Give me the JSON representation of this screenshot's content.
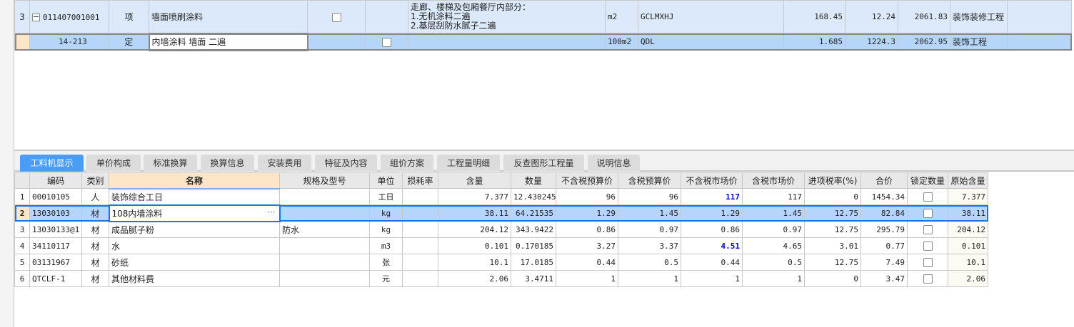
{
  "top_rows": [
    {
      "no": "3",
      "code": "011407001001",
      "type": "项",
      "name": "墙面喷刷涂料",
      "desc": [
        "走廊、楼梯及包厢餐厅内部分：",
        "1.无机涂料二遍",
        "2.基层刮防水腻子二遍"
      ],
      "unit": "m2",
      "expr": "GCLMXHJ",
      "qty": "168.45",
      "price": "12.24",
      "total": "2061.83",
      "category": "装饰装修工程"
    },
    {
      "no": "",
      "code": "14-213",
      "type": "定",
      "name": "内墙涂料 墙面 二遍",
      "desc": [],
      "unit": "100m2",
      "expr": "QDL",
      "qty": "1.685",
      "price": "1224.3",
      "total": "2062.95",
      "category": "装饰工程"
    }
  ],
  "tabs": [
    "工料机显示",
    "单价构成",
    "标准换算",
    "换算信息",
    "安装费用",
    "特征及内容",
    "组价方案",
    "工程量明细",
    "反查图形工程量",
    "说明信息"
  ],
  "headers": [
    "编码",
    "类别",
    "名称",
    "规格及型号",
    "单位",
    "损耗率",
    "含量",
    "数量",
    "不含税预算价",
    "含税预算价",
    "不含税市场价",
    "含税市场价",
    "进项税率(%)",
    "合价",
    "锁定数量",
    "原始含量"
  ],
  "rows": [
    {
      "no": "1",
      "code": "00010105",
      "type": "人",
      "name": "装饰综合工日",
      "spec": "",
      "unit": "工日",
      "loss": "",
      "content": "7.377",
      "count": "12.430245",
      "p1": "96",
      "p2": "96",
      "p3": "117",
      "p4": "117",
      "tax": "0",
      "sum": "1454.34",
      "orig": "7.377"
    },
    {
      "no": "2",
      "code": "13030103",
      "type": "材",
      "name": "108内墙涂料",
      "spec": "",
      "unit": "kg",
      "loss": "",
      "content": "38.11",
      "count": "64.21535",
      "p1": "1.29",
      "p2": "1.45",
      "p3": "1.29",
      "p4": "1.45",
      "tax": "12.75",
      "sum": "82.84",
      "orig": "38.11"
    },
    {
      "no": "3",
      "code": "13030133@1",
      "type": "材",
      "name": "成品腻子粉",
      "spec": "防水",
      "unit": "kg",
      "loss": "",
      "content": "204.12",
      "count": "343.9422",
      "p1": "0.86",
      "p2": "0.97",
      "p3": "0.86",
      "p4": "0.97",
      "tax": "12.75",
      "sum": "295.79",
      "orig": "204.12"
    },
    {
      "no": "4",
      "code": "34110117",
      "type": "材",
      "name": "水",
      "spec": "",
      "unit": "m3",
      "loss": "",
      "content": "0.101",
      "count": "0.170185",
      "p1": "3.27",
      "p2": "3.37",
      "p3": "4.51",
      "p4": "4.65",
      "tax": "3.01",
      "sum": "0.77",
      "orig": "0.101"
    },
    {
      "no": "5",
      "code": "03131967",
      "type": "材",
      "name": "砂纸",
      "spec": "",
      "unit": "张",
      "loss": "",
      "content": "10.1",
      "count": "17.0185",
      "p1": "0.44",
      "p2": "0.5",
      "p3": "0.44",
      "p4": "0.5",
      "tax": "12.75",
      "sum": "7.49",
      "orig": "10.1"
    },
    {
      "no": "6",
      "code": "QTCLF-1",
      "type": "材",
      "name": "其他材料费",
      "spec": "",
      "unit": "元",
      "loss": "",
      "content": "2.06",
      "count": "3.4711",
      "p1": "1",
      "p2": "1",
      "p3": "1",
      "p4": "1",
      "tax": "0",
      "sum": "3.47",
      "orig": "2.06"
    }
  ],
  "ellipsis": "···",
  "colors": {
    "active_tab": "#4a9cf5",
    "selected_row": "#b5d5fb",
    "highlight_price": "#0000ee"
  }
}
